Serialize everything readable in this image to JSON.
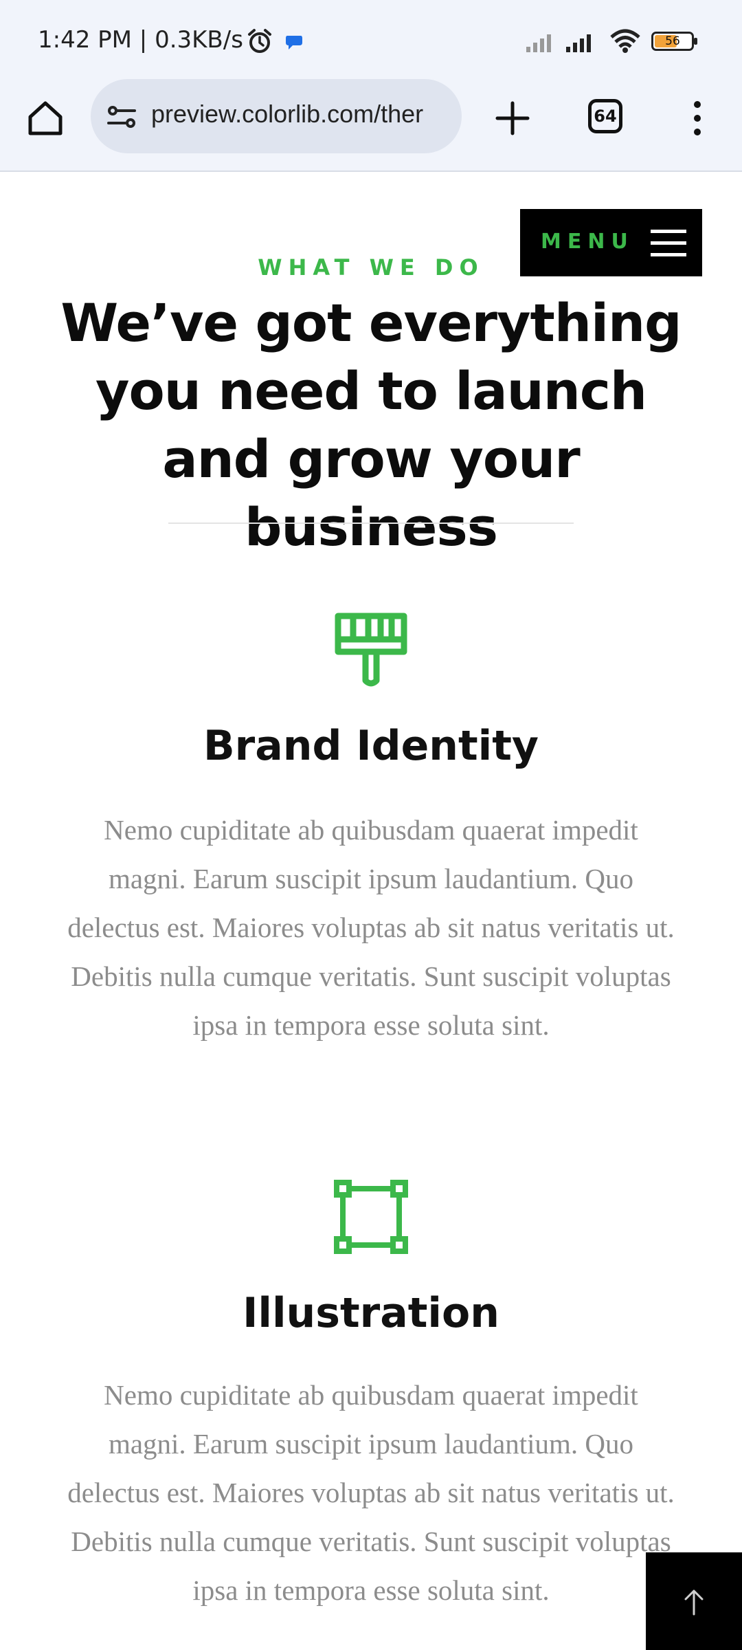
{
  "status_bar": {
    "time": "1:42 PM | 0.3KB/s",
    "battery": "56",
    "icons": [
      "alarm-icon",
      "notification-icon",
      "signal-icon",
      "wifi-icon",
      "battery-icon"
    ]
  },
  "browser": {
    "url": "preview.colorlib.com/ther",
    "tab_count": "64",
    "icons": [
      "home-icon",
      "site-settings-icon",
      "new-tab-icon",
      "tabs-icon",
      "more-icon"
    ]
  },
  "page": {
    "menu_label": "MENU",
    "kicker": "WHAT WE DO",
    "headline": "We’ve got everything you need to launch and grow your business",
    "services": [
      {
        "title": "Brand Identity",
        "icon": "paint-brush-icon",
        "description": "Nemo cupiditate ab quibusdam quaerat impedit magni. Earum suscipit ipsum laudantium. Quo delectus est. Maiores voluptas ab sit natus veritatis ut. Debitis nulla cumque veritatis. Sunt suscipit voluptas ipsa in tempora esse soluta sint."
      },
      {
        "title": "Illustration",
        "icon": "vector-square-icon",
        "description": "Nemo cupiditate ab quibusdam quaerat impedit magni. Earum suscipit ipsum laudantium. Quo delectus est. Maiores voluptas ab sit natus veritatis ut. Debitis nulla cumque veritatis. Sunt suscipit voluptas ipsa in tempora esse soluta sint."
      }
    ]
  },
  "colors": {
    "accent": "#3cb84a",
    "chrome_background": "#f1f4fb",
    "heading": "#0c0c0c",
    "body_text": "#8c8c8c"
  }
}
